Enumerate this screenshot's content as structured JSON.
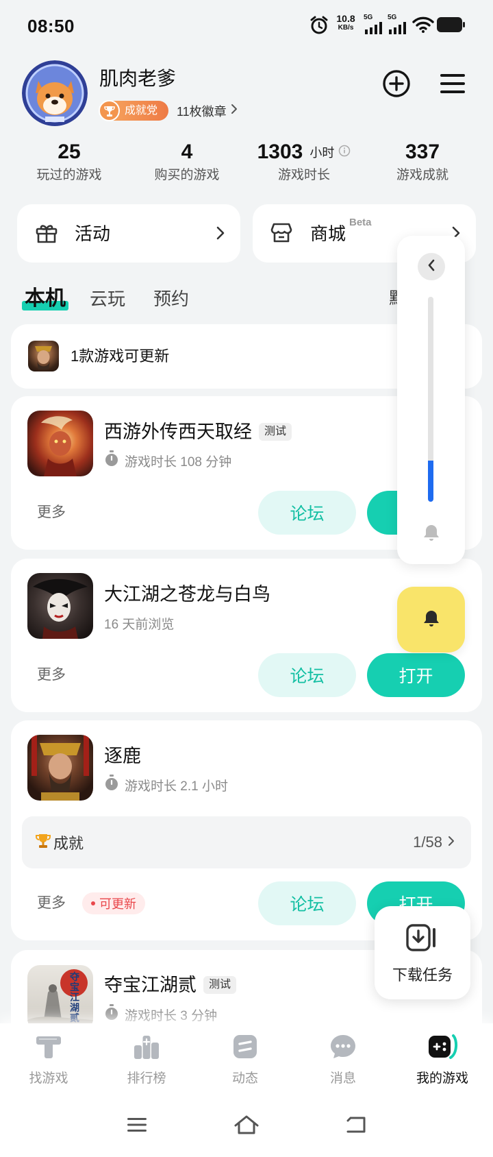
{
  "status_bar": {
    "time": "08:50",
    "net_speed": "10.8",
    "net_unit": "KB/s",
    "sim1": "5G",
    "sim2": "5G"
  },
  "profile": {
    "name": "肌肉老爹",
    "badge_label": "成就党",
    "badges_count": "11枚徽章"
  },
  "stats": [
    {
      "value": "25",
      "label": "玩过的游戏"
    },
    {
      "value": "4",
      "label": "购买的游戏"
    },
    {
      "value": "1303",
      "unit": "小时",
      "label": "游戏时长"
    },
    {
      "value": "337",
      "label": "游戏成就"
    }
  ],
  "quick_links": {
    "activity": "活动",
    "store": "商城",
    "store_tag": "Beta"
  },
  "tabs": {
    "items": [
      "本机",
      "云玩",
      "预约"
    ],
    "active": 0,
    "sort_partial": "默"
  },
  "update_banner": {
    "text": "1款游戏可更新"
  },
  "actions": {
    "more": "更多",
    "forum": "论坛",
    "open": "打开"
  },
  "games": [
    {
      "title": "西游外传西天取经",
      "tag": "测试",
      "meta": "游戏时长 108 分钟"
    },
    {
      "title": "大江湖之苍龙与白鸟",
      "meta": "16 天前浏览"
    },
    {
      "title": "逐鹿",
      "meta": "游戏时长 2.1 小时",
      "achievement_label": "成就",
      "achievement_progress": "1/58",
      "status": "可更新"
    },
    {
      "title": "夺宝江湖贰",
      "tag": "测试",
      "meta": "游戏时长 3 分钟",
      "icon_text": "夺宝江湖贰"
    }
  ],
  "floating_panel": {
    "slider_level": 0.2
  },
  "download_task": {
    "label": "下载任务"
  },
  "bottom_nav": {
    "items": [
      "找游戏",
      "排行榜",
      "动态",
      "消息",
      "我的游戏"
    ],
    "active": 4
  },
  "colors": {
    "accent": "#16CFB1",
    "accent_soft": "#E2F8F5",
    "warn": "#E9474B",
    "badge": "#F08A4B",
    "float_yellow": "#F9E46A",
    "slider": "#1E6BF0"
  }
}
